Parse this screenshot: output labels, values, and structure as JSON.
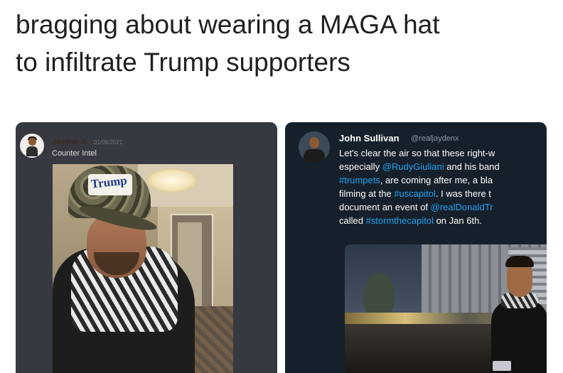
{
  "caption": {
    "line1": "bragging about wearing a MAGA hat",
    "line2": "to infiltrate Trump supporters"
  },
  "discord_post": {
    "username": "Jayden X",
    "timestamp": "01/06/2021",
    "status": "Counter Intel",
    "photo_cap_text": "Trump",
    "avatar": "user-avatar-icon"
  },
  "tweet": {
    "display_name": "John Sullivan",
    "handle": "@realjaydenx",
    "lines": [
      {
        "parts": [
          {
            "t": "Let's clear the air so that these right-w",
            "tag": false
          }
        ]
      },
      {
        "parts": [
          {
            "t": "especially ",
            "tag": false
          },
          {
            "t": "@RudyGiuliani",
            "tag": true
          },
          {
            "t": " and his band",
            "tag": false
          }
        ]
      },
      {
        "parts": [
          {
            "t": "#trumpets",
            "tag": true
          },
          {
            "t": ", are coming after me, a bla",
            "tag": false
          }
        ]
      },
      {
        "parts": [
          {
            "t": "filming at the ",
            "tag": false
          },
          {
            "t": "#uscapitol",
            "tag": true
          },
          {
            "t": ". I was there t",
            "tag": false
          }
        ]
      },
      {
        "parts": [
          {
            "t": "document an event of ",
            "tag": false
          },
          {
            "t": "@realDonaldTr",
            "tag": true
          }
        ]
      },
      {
        "parts": [
          {
            "t": "called ",
            "tag": false
          },
          {
            "t": "#stormthecapitol",
            "tag": true
          },
          {
            "t": " on Jan 6th.",
            "tag": false
          }
        ]
      }
    ],
    "link_color": "#1da1f2"
  }
}
